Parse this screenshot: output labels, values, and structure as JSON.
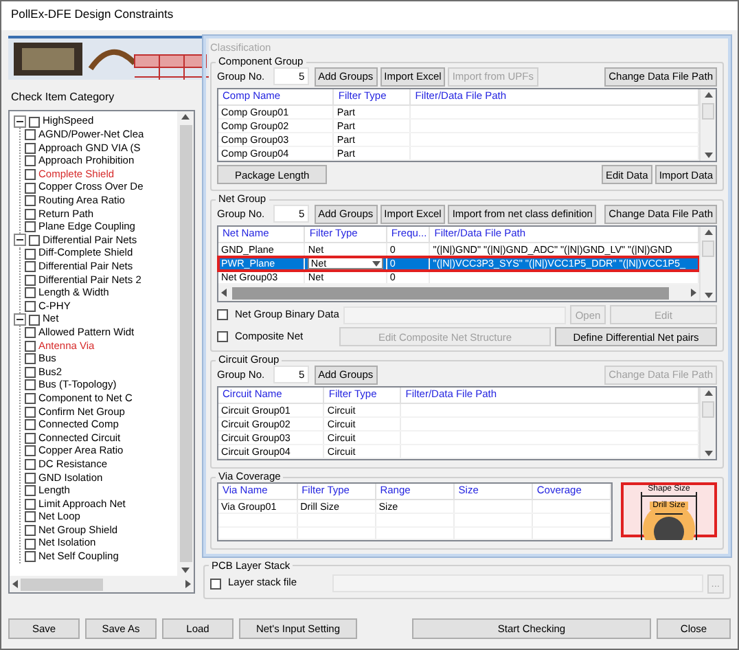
{
  "window": {
    "title": "PollEx-DFE Design Constraints"
  },
  "sidebar": {
    "label": "Check Item Category",
    "tree": [
      {
        "label": "HighSpeed",
        "expanded": true,
        "checked": false,
        "highlighted": false,
        "children": [
          {
            "label": "AGND/Power-Net Clea",
            "checked": false,
            "highlighted": false
          },
          {
            "label": "Approach GND VIA (S",
            "checked": false,
            "highlighted": false
          },
          {
            "label": "Approach Prohibition",
            "checked": false,
            "highlighted": false
          },
          {
            "label": "Complete Shield",
            "checked": false,
            "highlighted": true
          },
          {
            "label": "Copper Cross Over De",
            "checked": false,
            "highlighted": false
          },
          {
            "label": "Routing Area Ratio",
            "checked": false,
            "highlighted": false
          },
          {
            "label": "Return Path",
            "checked": false,
            "highlighted": false
          },
          {
            "label": "Plane Edge Coupling",
            "checked": false,
            "highlighted": false
          }
        ]
      },
      {
        "label": "Differential Pair Nets",
        "expanded": true,
        "checked": false,
        "highlighted": false,
        "children": [
          {
            "label": "Diff-Complete Shield",
            "checked": false,
            "highlighted": false
          },
          {
            "label": "Differential Pair Nets",
            "checked": false,
            "highlighted": false
          },
          {
            "label": "Differential Pair Nets 2",
            "checked": false,
            "highlighted": false
          },
          {
            "label": "Length & Width",
            "checked": false,
            "highlighted": false
          },
          {
            "label": "C-PHY",
            "checked": false,
            "highlighted": false
          }
        ]
      },
      {
        "label": "Net",
        "expanded": true,
        "checked": false,
        "highlighted": false,
        "children": [
          {
            "label": "Allowed Pattern Widt",
            "checked": false,
            "highlighted": false
          },
          {
            "label": "Antenna Via",
            "checked": false,
            "highlighted": true
          },
          {
            "label": "Bus",
            "checked": false,
            "highlighted": false
          },
          {
            "label": "Bus2",
            "checked": false,
            "highlighted": false
          },
          {
            "label": "Bus (T-Topology)",
            "checked": false,
            "highlighted": false
          },
          {
            "label": "Component to Net C",
            "checked": false,
            "highlighted": false
          },
          {
            "label": "Confirm Net Group",
            "checked": false,
            "highlighted": false
          },
          {
            "label": "Connected Comp",
            "checked": false,
            "highlighted": false
          },
          {
            "label": "Connected Circuit",
            "checked": false,
            "highlighted": false
          },
          {
            "label": "Copper Area Ratio",
            "checked": false,
            "highlighted": false
          },
          {
            "label": "DC Resistance",
            "checked": false,
            "highlighted": false
          },
          {
            "label": "GND Isolation",
            "checked": false,
            "highlighted": false
          },
          {
            "label": "Length",
            "checked": false,
            "highlighted": false
          },
          {
            "label": "Limit Approach Net",
            "checked": false,
            "highlighted": false
          },
          {
            "label": "Net Loop",
            "checked": false,
            "highlighted": false
          },
          {
            "label": "Net Group Shield",
            "checked": false,
            "highlighted": false
          },
          {
            "label": "Net Isolation",
            "checked": false,
            "highlighted": false
          },
          {
            "label": "Net Self Coupling",
            "checked": false,
            "highlighted": false
          }
        ]
      }
    ]
  },
  "classification": {
    "title": "Classification",
    "component_group": {
      "title": "Component Group",
      "group_no_label": "Group No.",
      "group_no": "5",
      "buttons": [
        {
          "label": "Add Groups",
          "disabled": false
        },
        {
          "label": "Import Excel",
          "disabled": false
        },
        {
          "label": "Import from UPFs",
          "disabled": true
        }
      ],
      "side_buttons": [
        {
          "label": "Change Data File Path",
          "disabled": false
        }
      ],
      "table": {
        "columns": [
          "Comp Name",
          "Filter Type",
          "Filter/Data File Path"
        ],
        "rows": [
          {
            "cells": [
              "Comp Group01",
              "Part"
            ],
            "selected": false
          },
          {
            "cells": [
              "Comp Group02",
              "Part"
            ],
            "selected": false
          },
          {
            "cells": [
              "Comp Group03",
              "Part"
            ],
            "selected": false
          },
          {
            "cells": [
              "Comp Group04",
              "Part"
            ],
            "selected": false
          }
        ]
      },
      "footer_buttons": [
        {
          "label": "Package Length",
          "disabled": false
        }
      ],
      "footer_side_buttons": [
        {
          "label": "Edit Data",
          "disabled": false
        },
        {
          "label": "Import Data",
          "disabled": false
        }
      ]
    },
    "net_group": {
      "title": "Net Group",
      "group_no_label": "Group No.",
      "group_no": "5",
      "buttons": [
        {
          "label": "Add Groups",
          "disabled": false
        },
        {
          "label": "Import Excel",
          "disabled": false
        },
        {
          "label": "Import from net class definition",
          "disabled": false
        }
      ],
      "side_buttons": [
        {
          "label": "Change Data File Path",
          "disabled": false
        }
      ],
      "table": {
        "columns": [
          "Net Name",
          "Filter Type",
          "Frequ...",
          "Filter/Data File Path"
        ],
        "rows": [
          {
            "cells": [
              "GND_Plane",
              "Net",
              "0",
              "\"(|N|)GND\" \"(|N|)GND_ADC\" \"(|N|)GND_LV\" \"(|N|)GND"
            ],
            "selected": false
          },
          {
            "cells": [
              "PWR_Plane",
              "Net",
              "0",
              "\"(|N|)VCC3P3_SYS\" \"(|N|)VCC1P5_DDR\" \"(|N|)VCC1P5_"
            ],
            "selected": true
          },
          {
            "cells": [
              "Net Group03",
              "Net",
              "0"
            ],
            "selected": false
          }
        ]
      },
      "options": [
        {
          "label": "Net Group Binary Data",
          "checked": false,
          "buttons": [
            {
              "label": "Open",
              "disabled": true
            },
            {
              "label": "Edit",
              "disabled": true
            }
          ]
        },
        {
          "label": "Composite Net",
          "checked": false,
          "buttons": [
            {
              "label": "Edit Composite Net Structure",
              "disabled": true
            },
            {
              "label": "Define Differential Net pairs",
              "disabled": false
            }
          ]
        }
      ]
    },
    "circuit_group": {
      "title": "Circuit Group",
      "group_no_label": "Group No.",
      "group_no": "5",
      "buttons": [
        {
          "label": "Add Groups",
          "disabled": false
        }
      ],
      "side_buttons": [
        {
          "label": "Change Data File Path",
          "disabled": true
        }
      ],
      "table": {
        "columns": [
          "Circuit Name",
          "Filter Type",
          "Filter/Data File Path"
        ],
        "rows": [
          {
            "cells": [
              "Circuit Group01",
              "Circuit"
            ],
            "selected": false
          },
          {
            "cells": [
              "Circuit Group02",
              "Circuit"
            ],
            "selected": false
          },
          {
            "cells": [
              "Circuit Group03",
              "Circuit"
            ],
            "selected": false
          },
          {
            "cells": [
              "Circuit Group04",
              "Circuit"
            ],
            "selected": false
          }
        ]
      }
    },
    "via_coverage": {
      "title": "Via Coverage",
      "table": {
        "columns": [
          "Via Name",
          "Filter Type",
          "Range",
          "Size",
          "Coverage"
        ],
        "rows": [
          {
            "cells": [
              "Via Group01",
              "Drill Size",
              "Size"
            ],
            "selected": false
          }
        ]
      },
      "diagram": {
        "shape_label": "Shape Size",
        "drill_label": "Drill Size"
      }
    }
  },
  "pcb_layer_stack": {
    "title": "PCB Layer Stack",
    "checkbox": {
      "label": "Layer stack file",
      "checked": false
    },
    "browse_button": {
      "label": "...",
      "disabled": true
    }
  },
  "buttons": [
    {
      "label": "Save",
      "disabled": false
    },
    {
      "label": "Save As",
      "disabled": false
    },
    {
      "label": "Load",
      "disabled": false
    },
    {
      "label": "Net's Input Setting",
      "disabled": false
    },
    {
      "label": "Start Checking",
      "disabled": false
    },
    {
      "label": "Close",
      "disabled": false
    }
  ]
}
